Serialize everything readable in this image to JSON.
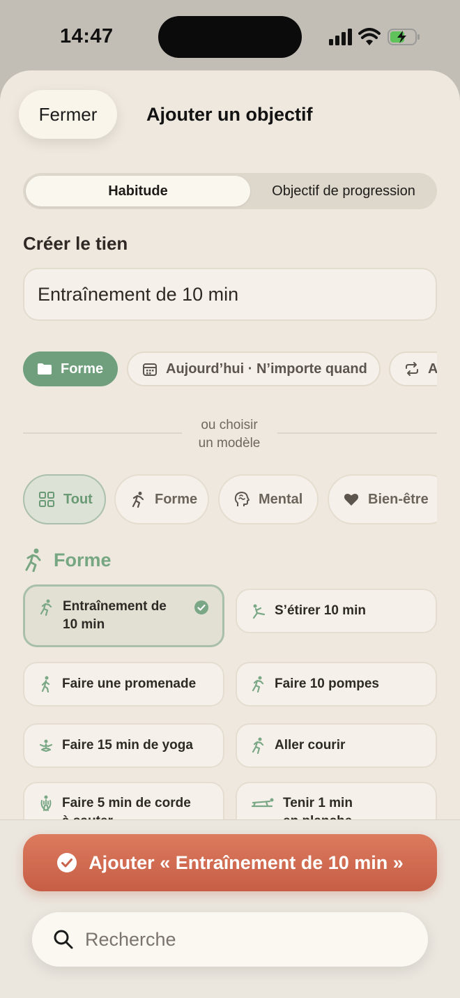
{
  "status_bar": {
    "time": "14:47"
  },
  "header": {
    "close_label": "Fermer",
    "title": "Ajouter un objectif"
  },
  "segment": {
    "options": [
      "Habitude",
      "Objectif de progression"
    ]
  },
  "form": {
    "section_label": "Créer le tien",
    "name_value": "Entraînement de 10 min",
    "chips": [
      {
        "label": "Forme",
        "icon": "folder-icon"
      },
      {
        "label": "Aujourd’hui · N’importe quand",
        "icon": "calendar-icon"
      },
      {
        "label": "A",
        "icon": "repeat-icon"
      }
    ]
  },
  "divider": {
    "line1": "ou choisir",
    "line2": "un modèle"
  },
  "categories": [
    {
      "label": "Tout",
      "icon": "grid-icon"
    },
    {
      "label": "Forme",
      "icon": "running-icon"
    },
    {
      "label": "Mental",
      "icon": "brain-icon"
    },
    {
      "label": "Bien-être",
      "icon": "heart-icon"
    }
  ],
  "template_group": {
    "title": "Forme",
    "items": [
      {
        "line1": "Entraînement de",
        "line2": "10 min",
        "icon": "running-icon",
        "selected": true
      },
      {
        "line1": "S’étirer 10 min",
        "line2": "",
        "icon": "stretch-icon",
        "selected": false
      },
      {
        "line1": "Faire une promenade",
        "line2": "",
        "icon": "walk-icon",
        "selected": false
      },
      {
        "line1": "Faire 10 pompes",
        "line2": "",
        "icon": "running-icon",
        "selected": false
      },
      {
        "line1": "Faire 15 min de yoga",
        "line2": "",
        "icon": "yoga-icon",
        "selected": false
      },
      {
        "line1": "Aller courir",
        "line2": "",
        "icon": "running-icon",
        "selected": false
      },
      {
        "line1": "Faire 5 min de corde",
        "line2": "à sauter",
        "icon": "jump-rope-icon",
        "selected": false
      },
      {
        "line1": "Tenir 1 min",
        "line2": "en planche",
        "icon": "plank-icon",
        "selected": false
      }
    ]
  },
  "footer": {
    "add_label": "Ajouter « Entraînement de 10 min »",
    "search_placeholder": "Recherche"
  },
  "colors": {
    "accent_green": "#6f9f7c",
    "add_button": "#cf6a4f",
    "sheet_bg": "#eee8de"
  }
}
